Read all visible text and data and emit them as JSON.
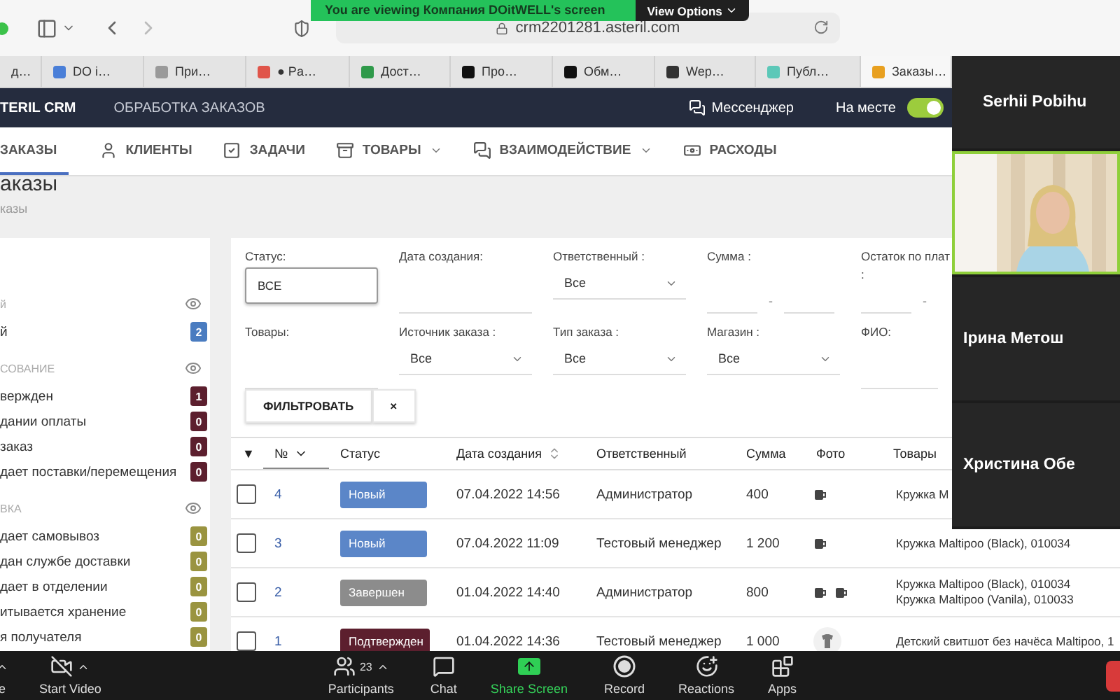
{
  "zoom_banner": {
    "text": "You are viewing Компания DOitWELL's screen",
    "menu": "View Options"
  },
  "browser": {
    "url": "crm2201281.asteril.com",
    "tabs": [
      {
        "label": "д…",
        "selected": false
      },
      {
        "label": "DO i…",
        "color": "#4a7fd8",
        "selected": false
      },
      {
        "label": "При…",
        "color": "#9a9a9a",
        "selected": false
      },
      {
        "label": "● Pa…",
        "color": "#e0554a",
        "selected": false
      },
      {
        "label": "Дост…",
        "color": "#2f9a4a",
        "selected": false
      },
      {
        "label": "Про…",
        "color": "#111111",
        "selected": false
      },
      {
        "label": "Обм…",
        "color": "#111111",
        "selected": false
      },
      {
        "label": "Wep…",
        "color": "#333333",
        "selected": false
      },
      {
        "label": "Публ…",
        "color": "#5cc8b8",
        "selected": false
      },
      {
        "label": "Заказы…",
        "color": "#e8a020",
        "selected": true
      }
    ]
  },
  "app_header": {
    "brand": "TERIL CRM",
    "section": "ОБРАБОТКА ЗАКАЗОВ",
    "messenger": "Мессенджер",
    "presence": {
      "label": "На месте",
      "on": true
    }
  },
  "nav": [
    {
      "label": "ЗАКАЗЫ",
      "kind": "plain",
      "selected": true,
      "dropdown": false
    },
    {
      "label": "КЛИЕНТЫ",
      "kind": "person",
      "selected": false,
      "dropdown": false
    },
    {
      "label": "ЗАДАЧИ",
      "kind": "tasks",
      "selected": false,
      "dropdown": false
    },
    {
      "label": "ТОВАРЫ",
      "kind": "box",
      "selected": false,
      "dropdown": true
    },
    {
      "label": "ВЗАИМОДЕЙСТВИЕ",
      "kind": "chat",
      "selected": false,
      "dropdown": true
    },
    {
      "label": "РАСХОДЫ",
      "kind": "money",
      "selected": false,
      "dropdown": false
    }
  ],
  "page": {
    "title": "аказы",
    "breadcrumb": "казы"
  },
  "sidebar": {
    "groups": [
      {
        "title": "й",
        "items": [
          {
            "label": "й",
            "count": "2",
            "color": "#4a7cc0"
          }
        ]
      },
      {
        "title": "СОВАНИЕ",
        "items": [
          {
            "label": "вержден",
            "count": "1",
            "color": "#5c1f2e"
          },
          {
            "label": "дании оплаты",
            "count": "0",
            "color": "#5c1f2e"
          },
          {
            "label": "заказ",
            "count": "0",
            "color": "#5c1f2e"
          },
          {
            "label": "дает поставки/перемещения",
            "count": "0",
            "color": "#5c1f2e"
          }
        ]
      },
      {
        "title": "ВКА",
        "items": [
          {
            "label": "дает самовывоз",
            "count": "0",
            "color": "#9a9440"
          },
          {
            "label": "дан службе доставки",
            "count": "0",
            "color": "#9a9440"
          },
          {
            "label": "дает в отделении",
            "count": "0",
            "color": "#9a9440"
          },
          {
            "label": "итывается хранение",
            "count": "0",
            "color": "#9a9440"
          },
          {
            "label": "я получателя",
            "count": "0",
            "color": "#9a9440"
          }
        ]
      }
    ]
  },
  "filters": [
    {
      "label": "Статус:",
      "kind": "boxed",
      "value": "ВСЕ"
    },
    {
      "label": "Дата создания:",
      "kind": "line"
    },
    {
      "label": "Ответственный :",
      "kind": "select",
      "value": "Все"
    },
    {
      "label": "Сумма :",
      "kind": "range",
      "separator": "-"
    },
    {
      "label": "Остаток по плат",
      "sublabel": ":",
      "kind": "range_start",
      "separator": "-"
    },
    {
      "label": "Товары:",
      "kind": "line"
    },
    {
      "label": "Источник заказа :",
      "kind": "select",
      "value": "Все"
    },
    {
      "label": "Тип заказа :",
      "kind": "select",
      "value": "Все"
    },
    {
      "label": "Магазин :",
      "kind": "select",
      "value": "Все"
    },
    {
      "label": "ФИО:",
      "kind": "line"
    }
  ],
  "filter_buttons": {
    "apply": "ФИЛЬТРОВАТЬ",
    "clear": "×"
  },
  "table": {
    "columns": [
      {
        "label": "▼",
        "kind": "plain",
        "selected": false
      },
      {
        "label": "№",
        "kind": "sort_down",
        "selected": true
      },
      {
        "label": "Статус",
        "kind": "plain",
        "selected": false
      },
      {
        "label": "Дата создания",
        "kind": "sortable",
        "selected": false
      },
      {
        "label": "Ответственный",
        "kind": "plain",
        "selected": false
      },
      {
        "label": "Сумма",
        "kind": "plain",
        "selected": false
      },
      {
        "label": "Фото",
        "kind": "plain",
        "selected": false
      },
      {
        "label": "Товары",
        "kind": "plain",
        "selected": false
      }
    ],
    "rows": [
      {
        "checked": false,
        "number": "4",
        "status": {
          "label": "Новый",
          "color": "#5b86c8"
        },
        "date": "07.04.2022 14:56",
        "manager": "Администратор",
        "sum": "400",
        "photos": [
          {
            "kind": "mug"
          }
        ],
        "products": [
          "Кружка M"
        ]
      },
      {
        "checked": false,
        "number": "3",
        "status": {
          "label": "Новый",
          "color": "#5b86c8"
        },
        "date": "07.04.2022 11:09",
        "manager": "Тестовый менеджер",
        "sum": "1 200",
        "photos": [
          {
            "kind": "mug"
          }
        ],
        "products": [
          "Кружка Maltipoo (Black), 010034"
        ]
      },
      {
        "checked": false,
        "number": "2",
        "status": {
          "label": "Завершен",
          "color": "#8c8c8c"
        },
        "date": "01.04.2022 14:40",
        "manager": "Администратор",
        "sum": "800",
        "photos": [
          {
            "kind": "mug"
          },
          {
            "kind": "mug"
          }
        ],
        "products": [
          "Кружка Maltipoo (Black), 010034",
          "Кружка Maltipoo (Vanila), 010033"
        ]
      },
      {
        "checked": false,
        "number": "1",
        "status": {
          "label": "Подтвержден",
          "color": "#5c1f2e"
        },
        "date": "01.04.2022 14:36",
        "manager": "Тестовый менеджер",
        "sum": "1 000",
        "photos": [
          {
            "kind": "shirt"
          }
        ],
        "products": [
          "Детский свитшот без начёса Maltipoo, 1"
        ]
      }
    ]
  },
  "participants": [
    {
      "name": "Serhii Pobihu",
      "kind": "name"
    },
    {
      "kind": "video",
      "selected": true
    },
    {
      "name": "Ірина Метош",
      "kind": "name"
    },
    {
      "name": "Христина  Обе",
      "kind": "name"
    }
  ],
  "zoom_toolbar": [
    {
      "label": "e",
      "kind": "text",
      "caret": true
    },
    {
      "label": "Start Video",
      "kind": "video_off",
      "caret": true
    },
    {
      "label": "Participants",
      "kind": "participants",
      "count": "23",
      "caret": true
    },
    {
      "label": "Chat",
      "kind": "chat",
      "caret": false
    },
    {
      "label": "Share Screen",
      "kind": "share",
      "caret": false
    },
    {
      "label": "Record",
      "kind": "record",
      "caret": false
    },
    {
      "label": "Reactions",
      "kind": "reactions",
      "caret": false
    },
    {
      "label": "Apps",
      "kind": "apps",
      "caret": false
    },
    {
      "kind": "end"
    }
  ]
}
